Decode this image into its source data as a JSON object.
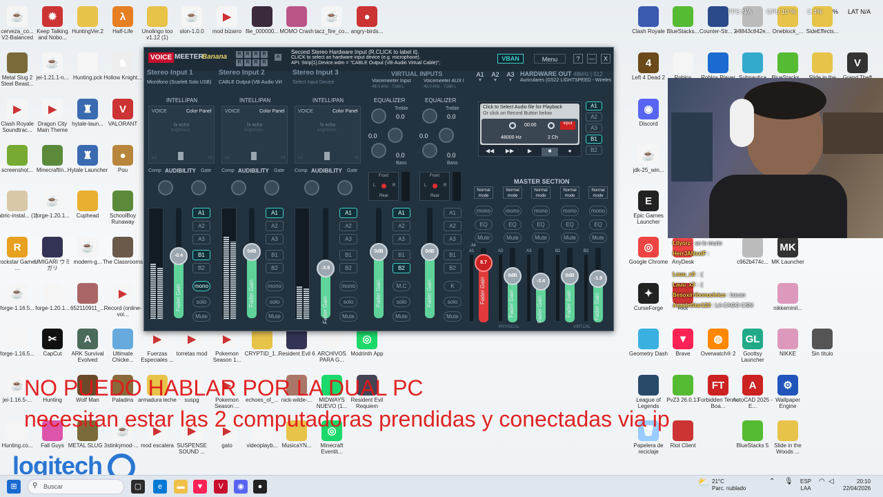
{
  "desktop_left": [
    {
      "label": "cerveza_co... V2-Balanced",
      "color": "#f5f5f5",
      "glyph": "☕"
    },
    {
      "label": "Keep Talking and Nobo...",
      "color": "#c33",
      "glyph": "✹"
    },
    {
      "label": "HuntingVer.2",
      "color": "#e8c34a",
      "glyph": ""
    },
    {
      "label": "Half-Life",
      "color": "#e67e22",
      "glyph": "λ"
    },
    {
      "label": "Unolingo too v1.12 (1)",
      "color": "#e8c34a",
      "glyph": ""
    },
    {
      "label": "slon-1.0.0",
      "color": "#f5f5f5",
      "glyph": "☕"
    },
    {
      "label": "mod bizarro",
      "color": "#f5f5f5",
      "glyph": "▶"
    },
    {
      "label": "file_000000...",
      "color": "#3a2a3a",
      "glyph": ""
    },
    {
      "label": "MOMO Crash",
      "color": "#b58",
      "glyph": ""
    },
    {
      "label": "tacz_fire_co...",
      "color": "#f5f5f5",
      "glyph": "☕"
    },
    {
      "label": "angry-birds...",
      "color": "#c33",
      "glyph": "●"
    },
    {
      "label": "Metal Slug 2 Steel Beast...",
      "color": "#7a6a3a",
      "glyph": ""
    },
    {
      "label": "jei-1.21.1-n...",
      "color": "#f5f5f5",
      "glyph": "☕"
    },
    {
      "label": "Hunting.pck",
      "color": "#f5f5f5",
      "glyph": ""
    },
    {
      "label": "Hollow Knight...",
      "color": "#eee",
      "glyph": "♞"
    },
    {
      "label": "Clash Royale Soundtrac...",
      "color": "#f5f5f5",
      "glyph": "▶"
    },
    {
      "label": "Dragon City Main Theme",
      "color": "#f5f5f5",
      "glyph": "▶"
    },
    {
      "label": "hytale-laun...",
      "color": "#3a6ab0",
      "glyph": "♜"
    },
    {
      "label": "VALORANT",
      "color": "#c33",
      "glyph": "V"
    },
    {
      "label": "screenshot...",
      "color": "#7a3",
      "glyph": ""
    },
    {
      "label": "MinecraftIn...",
      "color": "#5a8a3a",
      "glyph": ""
    },
    {
      "label": "Hytale Launcher",
      "color": "#3a6ab0",
      "glyph": "♜"
    },
    {
      "label": "Pou",
      "color": "#b8863b",
      "glyph": "●"
    },
    {
      "label": "fabric-instal... (1)",
      "color": "#d8c8a8",
      "glyph": ""
    },
    {
      "label": "forge-1.20.1...",
      "color": "#f5f5f5",
      "glyph": "☕"
    },
    {
      "label": "Cuphead",
      "color": "#e8b030",
      "glyph": ""
    },
    {
      "label": "SchoolBoy Runaway",
      "color": "#5a8a3a",
      "glyph": ""
    },
    {
      "label": "Rockstar Games ...",
      "color": "#e8a020",
      "glyph": "R"
    },
    {
      "label": "UMIGARI ウミガリ",
      "color": "#335",
      "glyph": ""
    },
    {
      "label": "modern-g...",
      "color": "#f5f5f5",
      "glyph": "☕"
    },
    {
      "label": "The Classrooms",
      "color": "#6a5a4a",
      "glyph": ""
    },
    {
      "label": "forge-1.16.5...",
      "color": "#f5f5f5",
      "glyph": "☕"
    },
    {
      "label": "forge-1.20.1...",
      "color": "#f5f5f5",
      "glyph": ""
    },
    {
      "label": "652110911_...",
      "color": "#a66",
      "glyph": ""
    },
    {
      "label": "Record (online-voi...",
      "color": "#f5f5f5",
      "glyph": "▶"
    },
    {
      "label": "forge-1.16.5...",
      "color": "#f5f5f5",
      "glyph": ""
    },
    {
      "label": "CapCut",
      "color": "#111",
      "glyph": "✂"
    },
    {
      "label": "ARK Survival Evolved",
      "color": "#4a6a5a",
      "glyph": "A"
    },
    {
      "label": "Ultimate Chicke...",
      "color": "#6ad",
      "glyph": ""
    },
    {
      "label": "Fuerzas Especiales ...",
      "color": "#f5f5f5",
      "glyph": "▶"
    },
    {
      "label": "torretas mod",
      "color": "#f5f5f5",
      "glyph": "▶"
    },
    {
      "label": "Pokemon Season 1...",
      "color": "#f5f5f5",
      "glyph": "▶"
    },
    {
      "label": "CRYPTID_1...",
      "color": "#e8c34a",
      "glyph": ""
    },
    {
      "label": "Resident Evil 6",
      "color": "#335",
      "glyph": ""
    },
    {
      "label": "ARCHIVOS PARA G...",
      "color": "#f5f5f5",
      "glyph": ""
    },
    {
      "label": "Modrinth App",
      "color": "#1bd96a",
      "glyph": "◎"
    },
    {
      "label": "jei-1.16.5-...",
      "color": "#f5f5f5",
      "glyph": "☕"
    },
    {
      "label": "Hunting",
      "color": "#f5f5f5",
      "glyph": ""
    },
    {
      "label": "Wolf Man",
      "color": "#6a4a2a",
      "glyph": ""
    },
    {
      "label": "Paladins",
      "color": "#8a6a3a",
      "glyph": ""
    },
    {
      "label": "armadura leche",
      "color": "#e8c34a",
      "glyph": ""
    },
    {
      "label": "suspg",
      "color": "#f5f5f5",
      "glyph": ""
    },
    {
      "label": "Pokemon Season ...",
      "color": "#f5f5f5",
      "glyph": "▶"
    },
    {
      "label": "echoes_of_...",
      "color": "#f5f5f5",
      "glyph": ""
    },
    {
      "label": "nick-wilde-...",
      "color": "#a76",
      "glyph": ""
    },
    {
      "label": "MIDWAYS NUEVO (1...",
      "color": "#1bd96a",
      "glyph": ""
    },
    {
      "label": "Resident Evil Requiem",
      "color": "#445",
      "glyph": ""
    },
    {
      "label": "Hunting.co...",
      "color": "#f5f5f5",
      "glyph": ""
    },
    {
      "label": "Fall Guys",
      "color": "#d5a",
      "glyph": ""
    },
    {
      "label": "METAL SLUG 3",
      "color": "#7a6a3a",
      "glyph": ""
    },
    {
      "label": "stinkymod-...",
      "color": "#f5f5f5",
      "glyph": "☕"
    },
    {
      "label": "mod escalera",
      "color": "#f5f5f5",
      "glyph": "▶"
    },
    {
      "label": "SUSPENSE SOUND ...",
      "color": "#f5f5f5",
      "glyph": "▶"
    },
    {
      "label": "gato",
      "color": "#f5f5f5",
      "glyph": "▶"
    },
    {
      "label": "videoplayb...",
      "color": "#f5f5f5",
      "glyph": ""
    },
    {
      "label": "MusicaYN...",
      "color": "#e8c34a",
      "glyph": ""
    },
    {
      "label": "Minecraft Eventit...",
      "color": "#1bd96a",
      "glyph": "◎"
    }
  ],
  "desktop_right": [
    {
      "label": "Clash Royale",
      "color": "#3a5ab0",
      "glyph": ""
    },
    {
      "label": "BlueStacks...",
      "color": "#5b3",
      "glyph": ""
    },
    {
      "label": "Counter-Str... 2",
      "color": "#2a4a8a",
      "glyph": ""
    },
    {
      "label": "e8843c842e...",
      "color": "#bbb",
      "glyph": ""
    },
    {
      "label": "Oneblock_...",
      "color": "#e8c34a",
      "glyph": ""
    },
    {
      "label": "SideEffects...",
      "color": "#e8c34a",
      "glyph": ""
    },
    {
      "label": "Left 4 Dead 2",
      "color": "#6a4a1a",
      "glyph": "4"
    },
    {
      "label": "Roblox",
      "color": "#f5f5f5",
      "glyph": ""
    },
    {
      "label": "Roblox Player",
      "color": "#1a6ad0",
      "glyph": ""
    },
    {
      "label": "Subnautica",
      "color": "#3ac",
      "glyph": ""
    },
    {
      "label": "BlueStacks...",
      "color": "#5b3",
      "glyph": ""
    },
    {
      "label": "Slide in the",
      "color": "#e8c34a",
      "glyph": ""
    },
    {
      "label": "Grand Theft",
      "color": "#333",
      "glyph": "V"
    },
    {
      "label": "Discord",
      "color": "#5865f2",
      "glyph": "◉"
    },
    {
      "label": "jdk-25_win...",
      "color": "#f5f5f5",
      "glyph": "☕"
    },
    {
      "label": "Epic Games Launcher",
      "color": "#222",
      "glyph": "E"
    },
    {
      "label": "Google Chrome",
      "color": "#e44",
      "glyph": "◎"
    },
    {
      "label": "CurseForge",
      "color": "#222",
      "glyph": "✦"
    },
    {
      "label": "Riot",
      "color": "#c33",
      "glyph": ""
    },
    {
      "label": "AnyDesk",
      "color": "#e44",
      "glyph": ""
    },
    {
      "label": "c962b474c...",
      "color": "#bbb",
      "glyph": ""
    },
    {
      "label": "MK Launcher",
      "color": "#333",
      "glyph": "MK"
    },
    {
      "label": "Geometry Dash",
      "color": "#3ab0e0",
      "glyph": ""
    },
    {
      "label": "Brave",
      "color": "#f25",
      "glyph": "▼"
    },
    {
      "label": "Overwatch® 2",
      "color": "#f80",
      "glyph": "◍"
    },
    {
      "label": "Goottsy Launcher",
      "color": "#2a8",
      "glyph": "GL"
    },
    {
      "label": "NIKKE",
      "color": "#d9b",
      "glyph": ""
    },
    {
      "label": "Sin título",
      "color": "#555",
      "glyph": ""
    },
    {
      "label": "nikkeminil...",
      "color": "#d9b",
      "glyph": ""
    },
    {
      "label": "League of Legends",
      "color": "#2a4a6a",
      "glyph": ""
    },
    {
      "label": "PvZ3 26.0.13",
      "color": "#5b3",
      "glyph": ""
    },
    {
      "label": "Forbidden Terror Boa...",
      "color": "#c22",
      "glyph": "FT"
    },
    {
      "label": "AutoCAD 2025 - E...",
      "color": "#c22",
      "glyph": "A"
    },
    {
      "label": "Wallpaper Engine",
      "color": "#25b",
      "glyph": "⚙"
    },
    {
      "label": "Papelera de reciclaje",
      "color": "#9cf",
      "glyph": "🗑"
    },
    {
      "label": "Riot Client",
      "color": "#c33",
      "glyph": ""
    },
    {
      "label": "BlueStacks 5",
      "color": "#5b3",
      "glyph": ""
    },
    {
      "label": "Slide in the Woods ...",
      "color": "#e8c34a",
      "glyph": ""
    }
  ],
  "tray_top": {
    "fps": "FPS N/A",
    "gpu": "GPU 10 %",
    "cpu": "C 4%",
    "pct": "%",
    "lat": "LAT N/A"
  },
  "voicemeeter": {
    "brand_voice": "VOICE",
    "brand_meeter": "MEETER",
    "brand_banana": "Banana",
    "info_line1": "Second Stereo Hardware Input (R.CLICK to label it).",
    "info_line2": "CLICK to select an hardware input device (e.g. microphone).",
    "info_line3": "API: Strip[1].Device.wdm = \"CABLE Output (VB-Audio Virtual Cable)\";",
    "vban": "VBAN",
    "menu": "Menu",
    "help": "?",
    "minimize": "—",
    "close": "X",
    "strips": [
      {
        "title": "Stereo Input 1",
        "device": "Micrófono (Scarlett Solo USB)",
        "gain": "-0.4",
        "fill": 0.56
      },
      {
        "title": "Stereo Input 2",
        "device": "CABLE Output (VB-Audio Virt",
        "gain": "0dB",
        "fill": 0.6
      },
      {
        "title": "Stereo Input 3",
        "device": "Select Input Device",
        "gain": "-3.9",
        "fill": 0.45
      }
    ],
    "virtual_title": "VIRTUAL INPUTS",
    "virtual": [
      {
        "name": "Voicemeeter Input",
        "rate": "48.0 kHz - 7168 L",
        "gain": "0dB"
      },
      {
        "name": "Voicemeeter AUX I",
        "rate": "48.0 kHz - 7168 L",
        "gain": "0dB"
      }
    ],
    "hw_out_title": "HARDWARE OUT",
    "hw_out_rate": "48kHz | 512",
    "hw_out_device": "Auriculares (G522 LIGHTSPEED - Wireles",
    "a_buttons": [
      "A1",
      "A2",
      "A3"
    ],
    "intellipan": "INTELLIPAN",
    "voice": "VOICE",
    "color_panel": "Color Panel",
    "fx_echo": "fx echo",
    "brightness": "brightness",
    "lo": "Lo",
    "hi": "Hi",
    "comp": "Comp",
    "audibility": "AUDIBILITY",
    "gate": "Gate",
    "equalizer": "EQUALIZER",
    "treble": "Treble",
    "bass": "Bass",
    "eq_zero": "0.0",
    "front": "Front",
    "rear": "Rear",
    "l": "L",
    "r": "R",
    "fader_gain": "Fader Gain",
    "bus_buttons": [
      "A1",
      "A2",
      "A3",
      "B1",
      "B2"
    ],
    "mono": "mono",
    "solo": "solo",
    "mute": "Mute",
    "mc": "M.C",
    "k": "K",
    "recorder": {
      "line1": "Click to Select Audio file for Playback",
      "line2": "Or click on Record Button below",
      "time": "00:00",
      "input": "input",
      "freq": "48000 Hz",
      "ch": "2 Ch"
    },
    "recorder_buses": [
      "A1",
      "A2",
      "A3",
      "B1",
      "B2"
    ],
    "master_title": "MASTER SECTION",
    "normal_mode": "Normal mode",
    "eq": "EQ",
    "masters": [
      {
        "name": "A1",
        "gain": "8.7",
        "red": true,
        "fill": 0.8
      },
      {
        "name": "A2",
        "gain": "0dB",
        "red": false,
        "fill": 0.62
      },
      {
        "name": "A3",
        "gain": "-3.4",
        "red": false,
        "fill": 0.55
      },
      {
        "name": "B1",
        "gain": "0dB",
        "red": false,
        "fill": 0.62
      },
      {
        "name": "B2",
        "gain": "-1.9",
        "red": false,
        "fill": 0.58
      }
    ],
    "physical": "PHYSICAL",
    "virtual_lbl": "VIRTUAL",
    "db_marker": "-34"
  },
  "overlay": {
    "line1": "NO PUEDO HABLAR POR LA DUAL PC",
    "line2": "necesitan estar las 2 computadoras prendidas y conectadas via ip"
  },
  "chat": [
    {
      "user": "Lilyorz",
      "msg": "se le murio"
    },
    {
      "user": "HerrJANxxIF",
      "msg": ""
    },
    {
      "user": "Lauu_x3",
      "msg": ":("
    },
    {
      "user": "Lauu_x3",
      "msg": ":("
    },
    {
      "user": "Besoxirribonucleico",
      "msg": "bacan"
    },
    {
      "user": "AsasinStar123",
      "msg": "LA CAGO CSM"
    }
  ],
  "logitech": "logitech",
  "taskbar": {
    "search": "Buscar",
    "weather_temp": "21°C",
    "weather_desc": "Parc. nublado",
    "lang": "ESP",
    "lang2": "LAA",
    "time": "20:10",
    "date": "22/04/2026"
  }
}
